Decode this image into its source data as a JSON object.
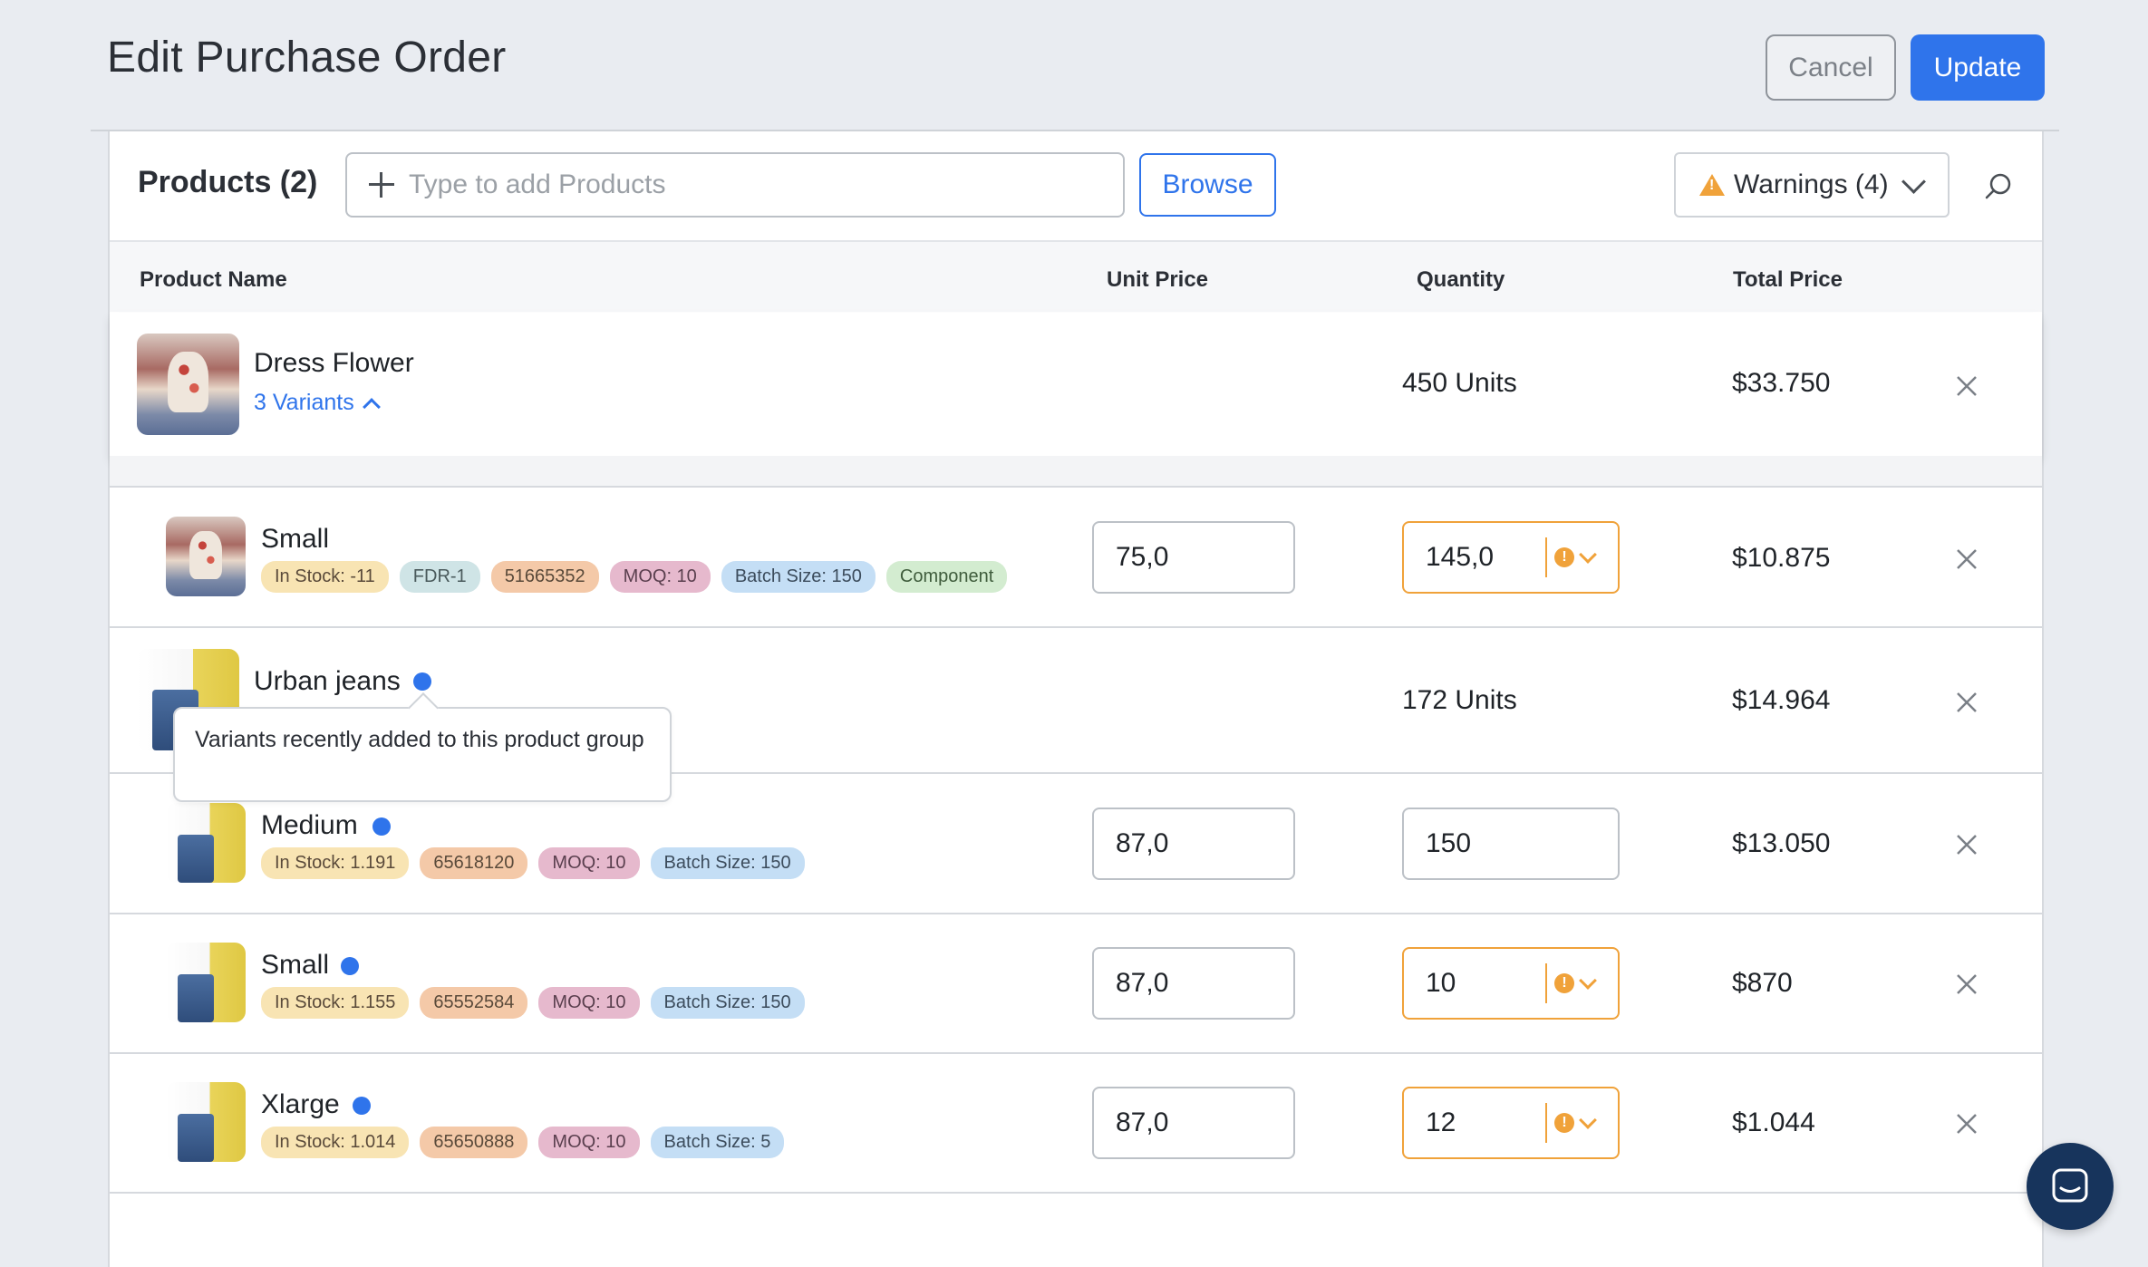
{
  "page": {
    "title": "Edit Purchase Order"
  },
  "actions": {
    "cancel_label": "Cancel",
    "update_label": "Update"
  },
  "toolbar": {
    "products_title": "Products (2)",
    "search_placeholder": "Type to add Products",
    "browse_label": "Browse",
    "warnings_label": "Warnings (4)"
  },
  "columns": {
    "product_name": "Product Name",
    "unit_price": "Unit Price",
    "quantity": "Quantity",
    "total_price": "Total Price"
  },
  "products": [
    {
      "name": "Dress Flower",
      "variants_link": "3 Variants",
      "quantity": "450 Units",
      "total": "$33.750",
      "variants": [
        {
          "name": "Small",
          "tags": [
            "In Stock: -11",
            "FDR-1",
            "51665352",
            "MOQ: 10",
            "Batch Size: 150",
            "Component"
          ],
          "unit_price": "75,0",
          "quantity": "145,0",
          "quantity_warning": true,
          "total": "$10.875"
        }
      ]
    },
    {
      "name": "Urban jeans",
      "quantity": "172 Units",
      "total": "$14.964",
      "tooltip": "Variants recently added to this product group",
      "variants": [
        {
          "name": "Medium",
          "tags": [
            "In Stock: 1.191",
            "65618120",
            "MOQ: 10",
            "Batch Size: 150"
          ],
          "unit_price": "87,0",
          "quantity": "150",
          "quantity_warning": false,
          "total": "$13.050"
        },
        {
          "name": "Small",
          "tags": [
            "In Stock: 1.155",
            "65552584",
            "MOQ: 10",
            "Batch Size: 150"
          ],
          "unit_price": "87,0",
          "quantity": "10",
          "quantity_warning": true,
          "total": "$870"
        },
        {
          "name": "Xlarge",
          "tags": [
            "In Stock: 1.014",
            "65650888",
            "MOQ: 10",
            "Batch Size: 5"
          ],
          "unit_price": "87,0",
          "quantity": "12",
          "quantity_warning": true,
          "total": "$1.044"
        }
      ]
    }
  ],
  "colors": {
    "accent": "#2f74eb",
    "warning": "#f0a23a",
    "chat": "#17345c"
  }
}
